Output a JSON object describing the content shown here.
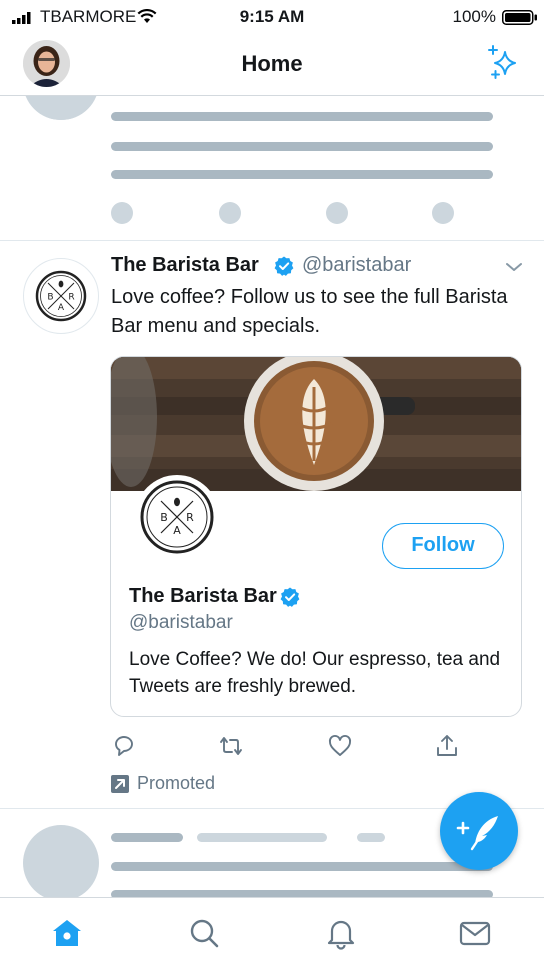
{
  "status_bar": {
    "carrier": "TBARMORE",
    "time": "9:15 AM",
    "battery": "100%"
  },
  "header": {
    "title": "Home",
    "avatar_icon": "profile-avatar",
    "sparkle_icon": "sparkle-icon"
  },
  "tweet": {
    "author_name": "The Barista Bar",
    "author_handle": "@baristabar",
    "text": "Love coffee? Follow us to see the full Barista Bar menu and specials.",
    "card": {
      "name": "The Barista Bar",
      "handle": "@baristabar",
      "bio": "Love Coffee? We do! Our espresso, tea and Tweets are freshly brewed.",
      "follow_label": "Follow",
      "logo_letters": [
        "B",
        "R",
        "A"
      ]
    },
    "promoted_label": "Promoted"
  },
  "colors": {
    "accent": "#1da1f2",
    "secondary_text": "#657786",
    "skeleton_dark": "#aab8c2",
    "skeleton_light": "#ccd6dd"
  },
  "tabs": [
    "home-icon",
    "search-icon",
    "notifications-icon",
    "messages-icon"
  ]
}
